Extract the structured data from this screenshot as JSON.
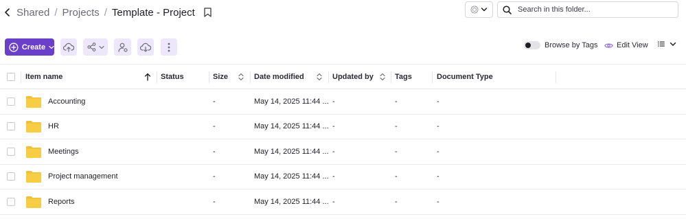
{
  "breadcrumb": {
    "items": [
      "Shared",
      "Projects"
    ],
    "separator": "/",
    "current": "Template - Project"
  },
  "search": {
    "placeholder": "Search in this folder..."
  },
  "toolbar": {
    "create_label": "Create",
    "icons": [
      "upload-icon",
      "share-icon",
      "manage-access-icon",
      "download-icon",
      "more-icon"
    ]
  },
  "view": {
    "browse_tags_label": "Browse by Tags",
    "browse_tags_enabled": false,
    "edit_view_label": "Edit View"
  },
  "table": {
    "headers": {
      "name": "Item name",
      "status": "Status",
      "size": "Size",
      "date": "Date modified",
      "updated_by": "Updated by",
      "tags": "Tags",
      "doc_type": "Document Type"
    },
    "rows": [
      {
        "name": "Accounting",
        "status": "",
        "size": "-",
        "date": "May 14, 2025 11:44 ...",
        "updated_by": "-",
        "tags": "-",
        "doc_type": "-"
      },
      {
        "name": "HR",
        "status": "",
        "size": "-",
        "date": "May 14, 2025 11:44 ...",
        "updated_by": "-",
        "tags": "-",
        "doc_type": "-"
      },
      {
        "name": "Meetings",
        "status": "",
        "size": "-",
        "date": "May 14, 2025 11:44 ...",
        "updated_by": "-",
        "tags": "-",
        "doc_type": "-"
      },
      {
        "name": "Project management",
        "status": "",
        "size": "-",
        "date": "May 14, 2025 11:44 ...",
        "updated_by": "-",
        "tags": "-",
        "doc_type": "-"
      },
      {
        "name": "Reports",
        "status": "",
        "size": "-",
        "date": "May 14, 2025 11:44 ...",
        "updated_by": "-",
        "tags": "-",
        "doc_type": "-"
      }
    ]
  },
  "colors": {
    "accent": "#6a3fc9",
    "accent_light": "#ece7fb",
    "folder": "#f7cd46",
    "folder_tab": "#eec03b"
  }
}
